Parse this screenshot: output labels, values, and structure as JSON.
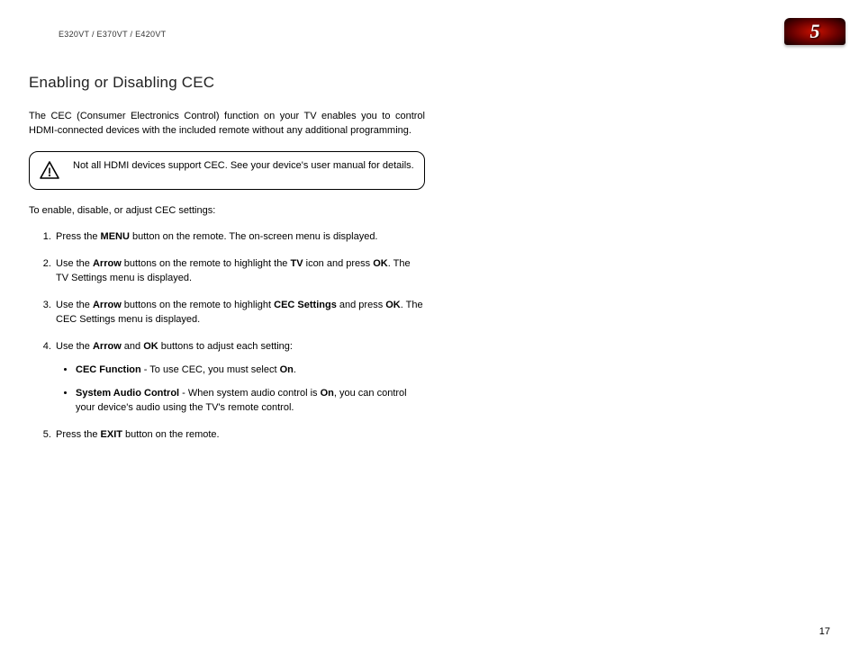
{
  "header": {
    "model": "E320VT / E370VT / E420VT",
    "chapter": "5"
  },
  "section": {
    "title": "Enabling or Disabling CEC",
    "intro": "The CEC (Consumer Electronics Control) function on your TV enables you to control HDMI-connected devices with the included remote without any additional programming.",
    "note": "Not all HDMI devices support CEC. See your device's user manual for details.",
    "lead_in": "To enable, disable, or adjust CEC settings:",
    "steps": {
      "s1_a": "Press the ",
      "s1_b": "MENU",
      "s1_c": " button on the remote. The on-screen menu is displayed.",
      "s2_a": "Use the ",
      "s2_b": "Arrow",
      "s2_c": " buttons on the remote to highlight the ",
      "s2_d": "TV",
      "s2_e": " icon and press ",
      "s2_f": "OK",
      "s2_g": ". The TV Settings menu is displayed.",
      "s3_a": "Use the ",
      "s3_b": "Arrow",
      "s3_c": " buttons on the remote to highlight ",
      "s3_d": "CEC Settings",
      "s3_e": " and press ",
      "s3_f": "OK",
      "s3_g": ". The CEC Settings menu is displayed.",
      "s4_a": "Use the ",
      "s4_b": "Arrow",
      "s4_c": " and ",
      "s4_d": "OK",
      "s4_e": " buttons to adjust each setting:",
      "b1_a": "CEC Function",
      "b1_b": " - To use CEC, you must select ",
      "b1_c": "On",
      "b1_d": ".",
      "b2_a": "System Audio Control",
      "b2_b": " - When system audio control is ",
      "b2_c": "On",
      "b2_d": ", you can control your device's audio using the TV's remote control.",
      "s5_a": "Press the ",
      "s5_b": "EXIT",
      "s5_c": " button on the remote."
    }
  },
  "page_number": "17"
}
